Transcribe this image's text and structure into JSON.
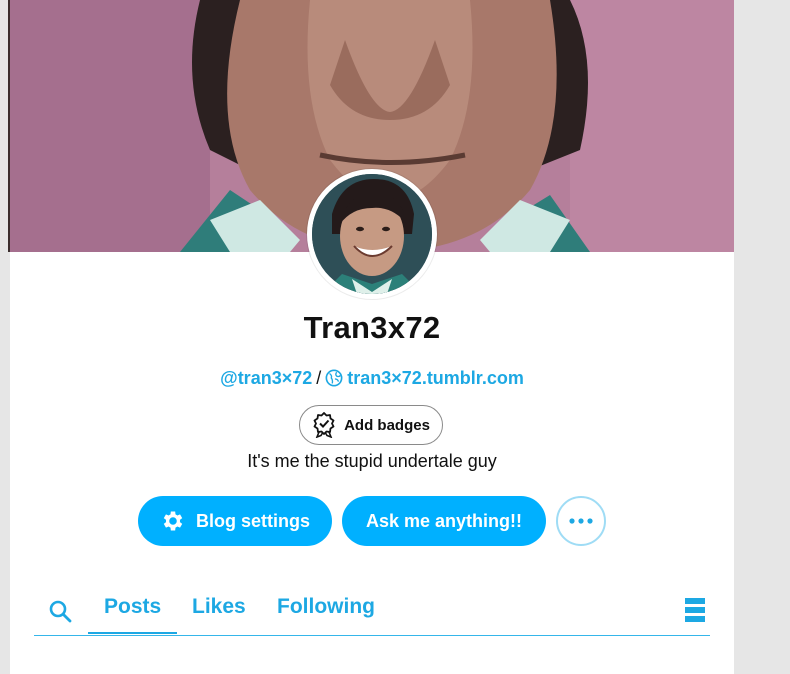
{
  "blog": {
    "title": "Tran3x72",
    "username": "@tran3×72",
    "separator": "/",
    "url": "tran3×72.tumblr.com",
    "description": "It's me the stupid undertale guy"
  },
  "badges": {
    "add_label": "Add badges"
  },
  "actions": {
    "blog_settings_label": "Blog settings",
    "ask_label": "Ask me anything!!"
  },
  "tabs": [
    {
      "label": "Posts",
      "active": true
    },
    {
      "label": "Likes"
    },
    {
      "label": "Following"
    }
  ],
  "colors": {
    "accent": "#00b0ff",
    "link": "#1da8e3",
    "header_bg": "#b27b97",
    "page_bg": "#e6e6e6"
  },
  "icons": {
    "settings": "gear-icon",
    "more": "ellipsis-icon",
    "search": "search-icon",
    "layout": "layout-icon",
    "badge": "badge-icon",
    "globe": "globe-icon"
  }
}
